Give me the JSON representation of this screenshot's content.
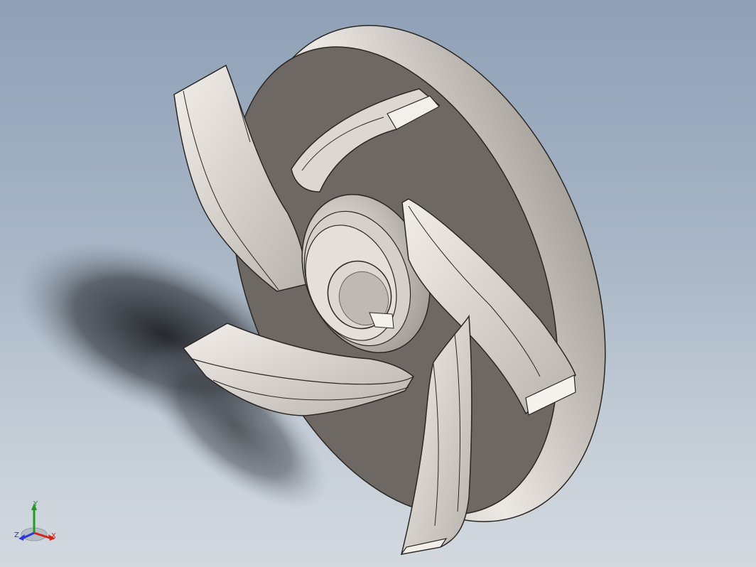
{
  "viewport": {
    "background_top": "#8fa0b6",
    "background_bottom": "#d3d9df"
  },
  "model": {
    "part": "impeller",
    "blade_count": 5,
    "body_color": "#6d6864",
    "face_color": "#d8d2cc",
    "edge_color": "#2a2622"
  },
  "triad": {
    "x_label": "X",
    "y_label": "Y",
    "z_label": "Z",
    "x_color": "#d3251c",
    "y_color": "#1f9b1f",
    "z_color": "#2b35d8"
  }
}
